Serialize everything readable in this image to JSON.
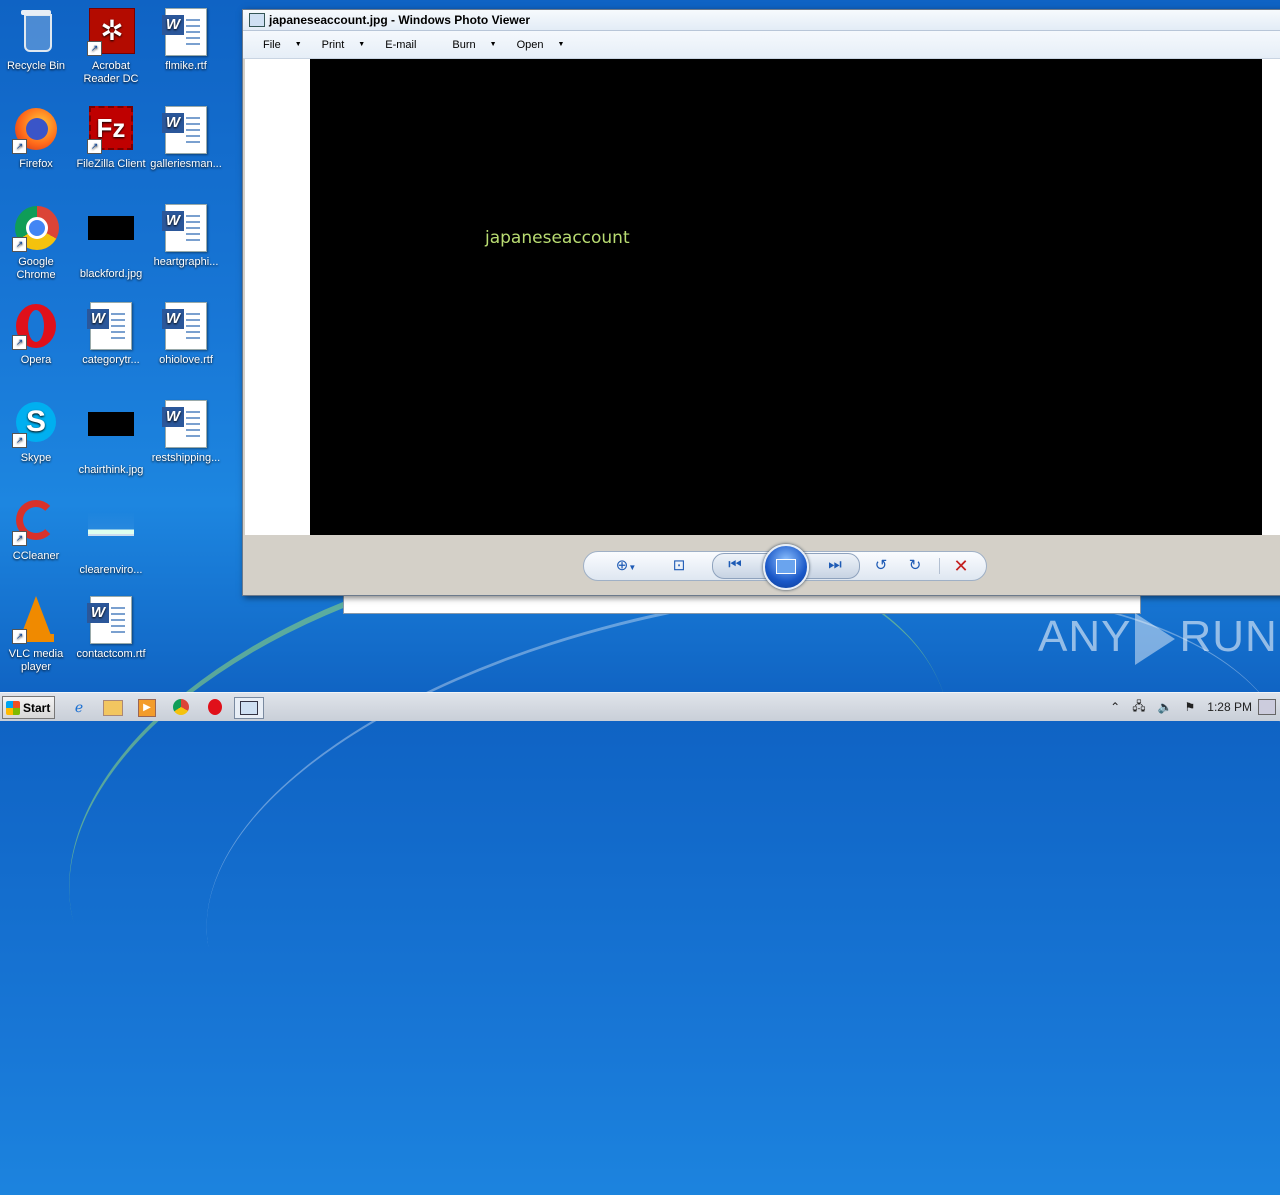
{
  "desktop": {
    "icons": [
      {
        "label": "Recycle Bin",
        "icon": "recycle-bin-icon"
      },
      {
        "label": "Acrobat Reader DC",
        "icon": "acrobat-icon"
      },
      {
        "label": "flmike.rtf",
        "icon": "word-doc-icon"
      },
      {
        "label": "Firefox",
        "icon": "firefox-icon"
      },
      {
        "label": "FileZilla Client",
        "icon": "filezilla-icon"
      },
      {
        "label": "galleriesman...",
        "icon": "word-doc-icon"
      },
      {
        "label": "Google Chrome",
        "icon": "chrome-icon"
      },
      {
        "label": "blackford.jpg",
        "icon": "image-thumb-icon"
      },
      {
        "label": "heartgraphi...",
        "icon": "word-doc-icon"
      },
      {
        "label": "Opera",
        "icon": "opera-icon"
      },
      {
        "label": "categorytr...",
        "icon": "word-doc-icon"
      },
      {
        "label": "ohiolove.rtf",
        "icon": "word-doc-icon"
      },
      {
        "label": "Skype",
        "icon": "skype-icon"
      },
      {
        "label": "chairthink.jpg",
        "icon": "image-thumb-icon"
      },
      {
        "label": "restshipping...",
        "icon": "word-doc-icon"
      },
      {
        "label": "CCleaner",
        "icon": "ccleaner-icon"
      },
      {
        "label": "clearenviro...",
        "icon": "image-thumb-icon"
      },
      {
        "label": "VLC media player",
        "icon": "vlc-icon"
      },
      {
        "label": "contactcom.rtf",
        "icon": "word-doc-icon"
      }
    ]
  },
  "viewer": {
    "title": "japaneseaccount.jpg - Windows Photo Viewer",
    "menu": {
      "file": "File",
      "print": "Print",
      "email": "E-mail",
      "burn": "Burn",
      "open": "Open"
    },
    "photo_text": "japaneseaccount"
  },
  "taskbar": {
    "start_label": "Start",
    "clock": "1:28 PM"
  },
  "watermark": {
    "left": "ANY",
    "right": "RUN"
  },
  "colors": {
    "photo_text": "#b9dc72",
    "desktop_bg": "#1877d6",
    "delete_red": "#c42020"
  }
}
